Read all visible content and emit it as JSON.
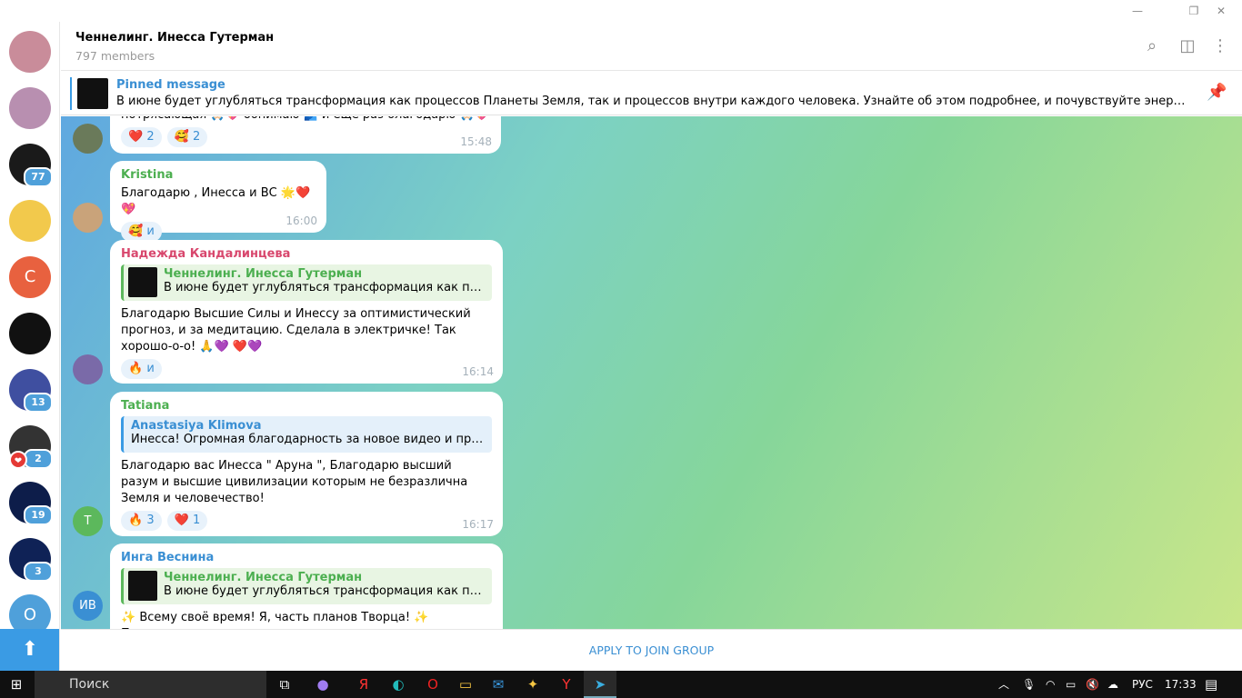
{
  "window": {
    "minimize": "—",
    "restore": "❐",
    "close": "✕"
  },
  "sidebar": {
    "avatars": [
      {
        "color": "#c98c9a",
        "badge": null
      },
      {
        "color": "#b88fb0",
        "badge": null
      },
      {
        "color": "#1a1a1a",
        "badge": "77"
      },
      {
        "color": "#f2c94c",
        "badge": null
      },
      {
        "color": "#e8613f",
        "letter": "C",
        "badge": null
      },
      {
        "color": "#111111",
        "badge": null
      },
      {
        "color": "#3f4fa0",
        "badge": "13"
      },
      {
        "color": "#333333",
        "badge": "2",
        "heart": "❤"
      },
      {
        "color": "#0d1d4a",
        "badge": "19"
      },
      {
        "color": "#0f2256",
        "badge": "3"
      },
      {
        "color": "#4fa0da",
        "letter": "O",
        "badge": null
      }
    ],
    "scroll_up": "⬆"
  },
  "header": {
    "title": "Ченнелинг. Инесса Гутерман",
    "members": "797 members",
    "icons": [
      "search-icon",
      "sidebar-toggle-icon",
      "more-vertical-icon"
    ]
  },
  "pinned": {
    "title": "Pinned message",
    "text": "В июне будет углубляться трансформация как процессов Планеты Земля, так и процессов внутри каждого человека. Узнайте об этом подробнее, и почувствуйте энергии гармонии в медитации"
  },
  "messages": [
    {
      "text": "потрясающая 🙏🏻💖 обнимаю 🫂 и еще раз благодарю 🙏🏻💖",
      "reactions": [
        {
          "emoji": "❤️",
          "count": "2"
        },
        {
          "emoji": "🥰",
          "count": "2"
        }
      ],
      "time": "15:48"
    },
    {
      "author": "Kristina",
      "author_color": "#4caf50",
      "text": "Благодарю , Инесса и ВС 🌟❤️💖",
      "reactions": [
        {
          "emoji": "🥰",
          "count": "и"
        }
      ],
      "time": "16:00"
    },
    {
      "author": "Надежда Кандалинцева",
      "author_color": "#d8476d",
      "reply": {
        "name": "Ченнелинг. Инесса Гутерман",
        "text": "В июне будет углубляться трансформация как процессов Планеты Земля"
      },
      "text": "Благодарю Высшие Силы и Инессу за оптимистический прогноз, и за медитацию. Сделала в электричке! Так хорошо-о-о! 🙏💜 ❤️💜",
      "reactions": [
        {
          "emoji": "🔥",
          "count": "и"
        }
      ],
      "time": "16:14"
    },
    {
      "author": "Tatiana",
      "author_color": "#4caf50",
      "avatar_letter": "T",
      "reply": {
        "name": "Anastasiya Klimova",
        "text": "Инесса! Огромная благодарность за новое видео и прогноз ..."
      },
      "text": "Благодарю вас Инесса \" Аруна \", Благодарю высший разум и высшие цивилизации которым не безразлична Земля и человечество!",
      "reactions": [
        {
          "emoji": "🔥",
          "count": "3"
        },
        {
          "emoji": "❤️",
          "count": "1"
        }
      ],
      "time": "16:17"
    },
    {
      "author": "Инга Веснина",
      "author_color": "#3a8fd3",
      "avatar_letter": "ИВ",
      "reply": {
        "name": "Ченнелинг. Инесса Гутерман",
        "text": "В июне будет углубляться трансформация как процессов Планеты Земля"
      },
      "text": "✨ Всему своё время! Я, часть планов Творца! ✨ Принимаю с"
    }
  ],
  "footer": {
    "join": "APPLY TO JOIN GROUP"
  },
  "taskbar": {
    "search": "Поиск",
    "lang": "РУС",
    "time": "17:33"
  }
}
